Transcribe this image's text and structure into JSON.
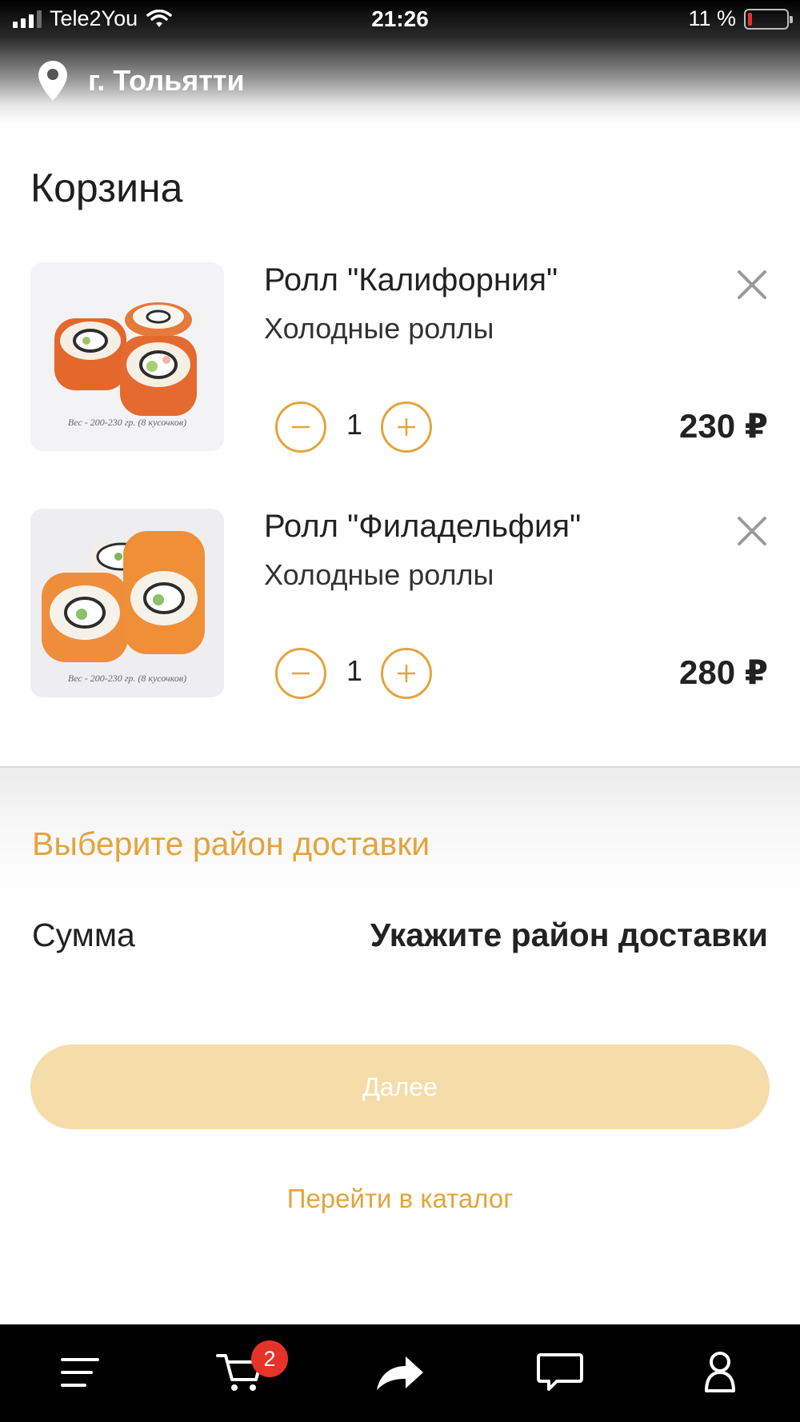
{
  "status_bar": {
    "carrier": "Tele2You",
    "time": "21:26",
    "battery_text": "11 %",
    "battery_level": 0.11
  },
  "header": {
    "city": "г. Тольятти",
    "location_icon": "map-pin-icon"
  },
  "cart": {
    "title": "Корзина",
    "items": [
      {
        "name": "Ролл \"Калифорния\"",
        "category": "Холодные роллы",
        "quantity": "1",
        "price": "230 ₽",
        "image_caption": "Вес - 200-230 гр. (8 кусочков)"
      },
      {
        "name": "Ролл \"Филадельфия\"",
        "category": "Холодные роллы",
        "quantity": "1",
        "price": "280 ₽",
        "image_caption": "Вес - 200-230 гр. (8 кусочков)"
      }
    ]
  },
  "delivery": {
    "choose_district": "Выберите район доставки"
  },
  "summary": {
    "label": "Сумма",
    "value": "Укажите район доставки"
  },
  "actions": {
    "next_label": "Далее",
    "catalog_label": "Перейти в каталог"
  },
  "tab_bar": {
    "cart_badge": "2",
    "icons": [
      "menu-icon",
      "cart-icon",
      "share-icon",
      "chat-icon",
      "profile-icon"
    ]
  },
  "colors": {
    "accent": "#e3a43d",
    "button_disabled": "#f5ddaa",
    "badge": "#e5332a"
  }
}
